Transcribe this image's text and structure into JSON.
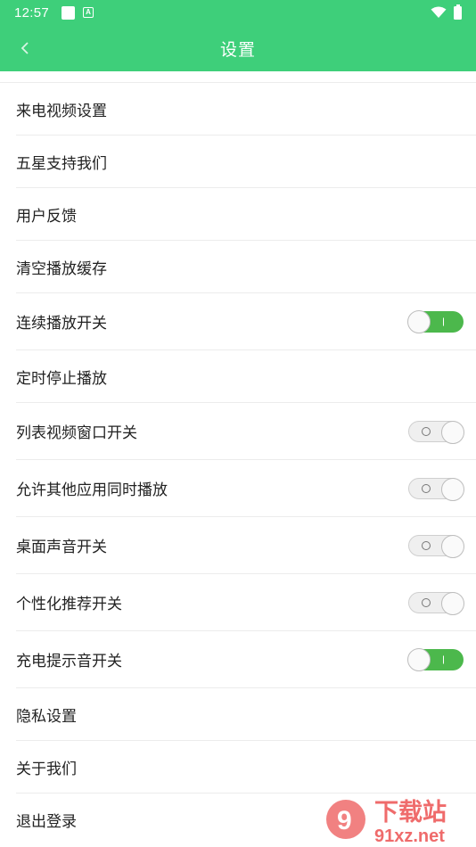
{
  "status_bar": {
    "time": "12:57",
    "a_label": "A"
  },
  "app_bar": {
    "title": "设置",
    "back_icon": "chevron-left-icon"
  },
  "colors": {
    "accent": "#3ecf7a",
    "toggle_on": "#4cb84c",
    "divider": "#ececec"
  },
  "settings": [
    {
      "label": "来电视频设置"
    },
    {
      "label": "五星支持我们"
    },
    {
      "label": "用户反馈"
    },
    {
      "label": "清空播放缓存"
    },
    {
      "label": "连续播放开关",
      "toggle": "on"
    },
    {
      "label": "定时停止播放"
    },
    {
      "label": "列表视频窗口开关",
      "toggle": "off"
    },
    {
      "label": "允许其他应用同时播放",
      "toggle": "off"
    },
    {
      "label": "桌面声音开关",
      "toggle": "off"
    },
    {
      "label": "个性化推荐开关",
      "toggle": "off"
    },
    {
      "label": "充电提示音开关",
      "toggle": "on"
    },
    {
      "label": "隐私设置"
    },
    {
      "label": "关于我们"
    },
    {
      "label": "退出登录"
    }
  ],
  "watermark": {
    "title": "下载站",
    "domain": "91xz.net",
    "logo_text": "9"
  }
}
